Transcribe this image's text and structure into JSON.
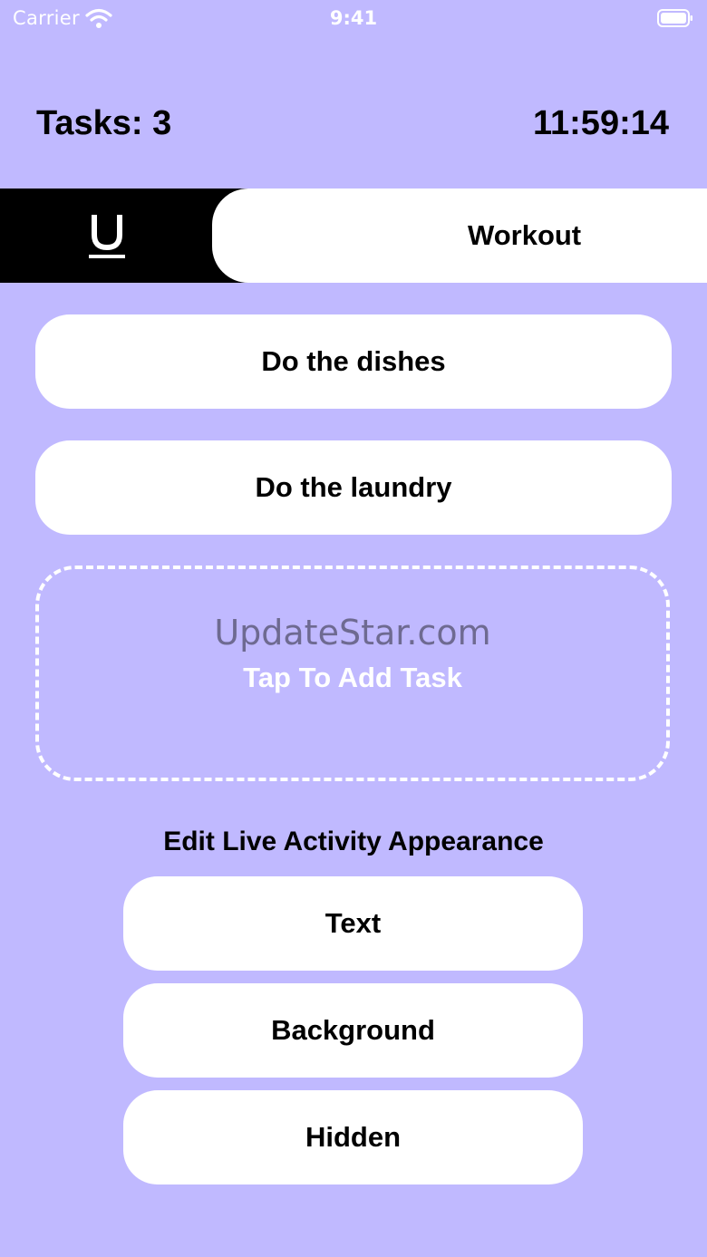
{
  "status_bar": {
    "carrier": "Carrier",
    "time": "9:41",
    "wifi_icon": "wifi-icon",
    "battery_icon": "battery-icon"
  },
  "header": {
    "tasks_count": "Tasks: 3",
    "timer": "11:59:14"
  },
  "category": {
    "icon": "underline-icon",
    "active_label": "Workout"
  },
  "tasks": [
    {
      "label": "Do the dishes"
    },
    {
      "label": "Do the laundry"
    }
  ],
  "add_task": {
    "watermark": "UpdateStar.com",
    "label": "Tap To Add Task"
  },
  "appearance": {
    "title": "Edit Live Activity Appearance",
    "options": [
      {
        "label": "Text"
      },
      {
        "label": "Background"
      },
      {
        "label": "Hidden"
      }
    ]
  },
  "colors": {
    "background": "#c0b9ff",
    "card": "#ffffff",
    "text": "#000000",
    "watermark": "#6e6a91"
  }
}
